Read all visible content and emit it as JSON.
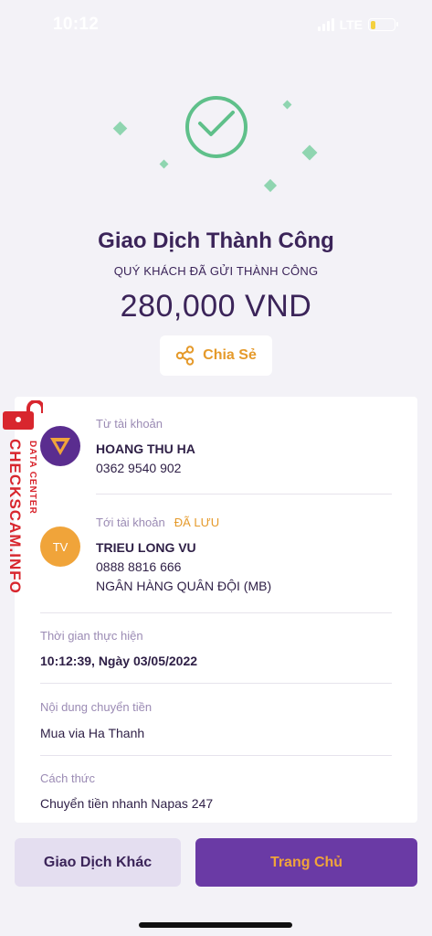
{
  "status_bar": {
    "time": "10:12",
    "network": "LTE",
    "battery_level": 0.15
  },
  "result": {
    "title": "Giao Dịch Thành Công",
    "subtitle": "QUÝ KHÁCH ĐÃ GỬI THÀNH CÔNG",
    "amount": "280,000 VND",
    "share_label": "Chia Sẻ"
  },
  "from_account": {
    "label": "Từ tài khoản",
    "name": "HOANG THU HA",
    "number": "0362 9540 902"
  },
  "to_account": {
    "label": "Tới tài khoản",
    "saved_badge": "ĐÃ LƯU",
    "avatar_initials": "TV",
    "name": "TRIEU LONG VU",
    "number": "0888 8816 666",
    "bank": "NGÂN HÀNG QUÂN ĐỘI (MB)"
  },
  "details": [
    {
      "label": "Thời gian thực hiện",
      "value": "10:12:39, Ngày 03/05/2022"
    },
    {
      "label": "Nội dung chuyển tiền",
      "value": "Mua via Ha Thanh"
    },
    {
      "label": "Cách thức",
      "value": "Chuyển tiền nhanh Napas 247"
    }
  ],
  "actions": {
    "other_transaction": "Giao Dịch Khác",
    "home": "Trang Chủ"
  },
  "watermark": {
    "main": "CHECKSCAM.INFO",
    "sub": "DATA CENTER"
  },
  "colors": {
    "accent_purple": "#6a3aa5",
    "accent_orange": "#e59a2b",
    "success_green": "#5fc08a",
    "text_dark": "#3b2459"
  }
}
